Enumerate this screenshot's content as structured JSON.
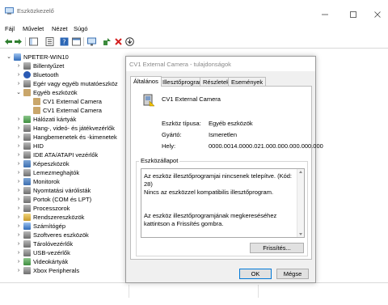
{
  "window": {
    "title": "Eszközkezelő"
  },
  "menu": [
    "Fájl",
    "Művelet",
    "Nézet",
    "Súgó"
  ],
  "toolbar": {
    "icons": [
      "back-arrow",
      "forward-arrow",
      "show-hide-tree",
      "properties",
      "help",
      "view",
      "update-driver",
      "scan-hardware",
      "uninstall",
      "download"
    ]
  },
  "tree": {
    "root": "NPETER-WIN10",
    "items": [
      {
        "label": "Billentyűzet",
        "icon": "keyboard-icon"
      },
      {
        "label": "Bluetooth",
        "icon": "bluetooth-icon"
      },
      {
        "label": "Egér vagy egyéb mutatóeszköz",
        "icon": "mouse-icon"
      },
      {
        "label": "Egyéb eszközök",
        "icon": "other-devices-icon",
        "expanded": true
      },
      {
        "label": "CV1 External Camera",
        "icon": "unknown-device-icon",
        "child": true
      },
      {
        "label": "CV1 External Camera",
        "icon": "unknown-device-icon",
        "child": true
      },
      {
        "label": "Hálózati kártyák",
        "icon": "network-adapter-icon"
      },
      {
        "label": "Hang-, videó- és játékvezérlők",
        "icon": "sound-icon"
      },
      {
        "label": "Hangbemenetek és -kimenetek",
        "icon": "audio-io-icon"
      },
      {
        "label": "HID",
        "icon": "hid-icon"
      },
      {
        "label": "IDE ATA/ATAPI vezérlők",
        "icon": "ide-icon"
      },
      {
        "label": "Képeszközök",
        "icon": "camera-icon"
      },
      {
        "label": "Lemezmeghajtók",
        "icon": "disk-icon"
      },
      {
        "label": "Monitorok",
        "icon": "monitor-icon"
      },
      {
        "label": "Nyomtatási várólisták",
        "icon": "printer-icon"
      },
      {
        "label": "Portok (COM és LPT)",
        "icon": "port-icon"
      },
      {
        "label": "Processzorok",
        "icon": "processor-icon"
      },
      {
        "label": "Rendszereszközök",
        "icon": "system-icon"
      },
      {
        "label": "Számítógép",
        "icon": "computer-icon"
      },
      {
        "label": "Szoftveres eszközök",
        "icon": "software-icon"
      },
      {
        "label": "Tárolóvezérlők",
        "icon": "storage-icon"
      },
      {
        "label": "USB-vezérlők",
        "icon": "usb-icon"
      },
      {
        "label": "Videokártyák",
        "icon": "display-adapter-icon"
      },
      {
        "label": "Xbox Peripherals",
        "icon": "xbox-icon"
      }
    ]
  },
  "dialog": {
    "title": "CV1 External Camera - tulajdonságok",
    "tabs": [
      "Általános",
      "Illesztőprogram",
      "Részletek",
      "Események"
    ],
    "device_name": "CV1 External Camera",
    "props": [
      {
        "label": "Eszköz típusa:",
        "value": "Egyéb eszközök"
      },
      {
        "label": "Gyártó:",
        "value": "Ismeretlen"
      },
      {
        "label": "Hely:",
        "value": "0000.0014.0000.021.000.000.000.000.000"
      }
    ],
    "status_title": "Eszközállapot",
    "status_lines": [
      "Az eszköz illesztőprogramjai nincsenek telepítve. (Kód: 28)",
      "Nincs az eszközzel kompatibilis illesztőprogram.",
      "Az eszköz illesztőprogramjának megkereséséhez kattintson a Frissítés gombra."
    ],
    "refresh_button": "Frissítés...",
    "ok_button": "OK",
    "cancel_button": "Mégse"
  }
}
